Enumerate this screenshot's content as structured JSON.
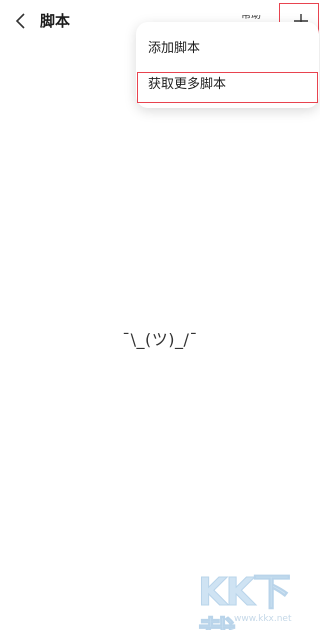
{
  "header": {
    "title": "脚本",
    "help_label": "帮助"
  },
  "menu": {
    "items": [
      {
        "label": "添加脚本"
      },
      {
        "label": "获取更多脚本"
      }
    ]
  },
  "empty_state": {
    "text": "¯\\_(ツ)_/¯"
  },
  "watermark": {
    "logo_text": "KK下载",
    "url": "www.kkx.net"
  },
  "colors": {
    "highlight": "#e8434f",
    "background": "#ffffff",
    "watermark": "#cfe3f3"
  }
}
